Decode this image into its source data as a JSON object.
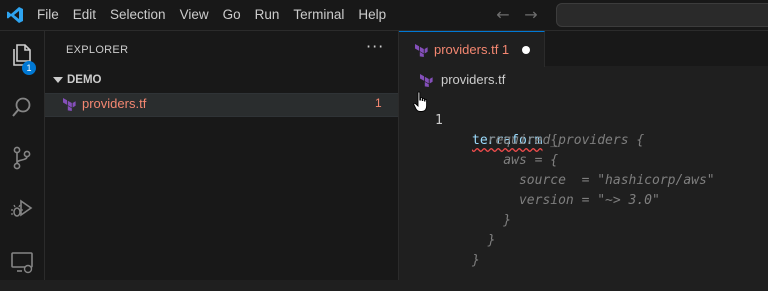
{
  "menu": [
    "File",
    "Edit",
    "Selection",
    "View",
    "Go",
    "Run",
    "Terminal",
    "Help"
  ],
  "activity_bar": {
    "explorer_badge": "1",
    "items": [
      "files-icon",
      "search-icon",
      "source-control-icon",
      "run-debug-icon",
      "remote-explorer-icon"
    ]
  },
  "sidebar": {
    "title": "EXPLORER",
    "more_actions": "···",
    "section": "DEMO",
    "files": [
      {
        "name": "providers.tf",
        "problems": "1",
        "icon": "terraform-icon"
      }
    ]
  },
  "editor": {
    "tab": {
      "label": "providers.tf",
      "problems": "1",
      "dirty": true
    },
    "tab_label_full": "providers.tf 1",
    "breadcrumb": "providers.tf",
    "code": [
      {
        "line": "1",
        "text": "terraform {"
      },
      {
        "line": "",
        "text": "  required_providers {"
      },
      {
        "line": "",
        "text": "    aws = {"
      },
      {
        "line": "",
        "text": "      source  = \"hashicorp/aws\""
      },
      {
        "line": "",
        "text": "      version = \"~> 3.0\""
      },
      {
        "line": "",
        "text": "    }"
      },
      {
        "line": "",
        "text": "  }"
      },
      {
        "line": "",
        "text": "}"
      }
    ]
  },
  "colors": {
    "accent": "#0078d4",
    "error_text": "#f48771",
    "terraform_purple": "#844fba"
  }
}
